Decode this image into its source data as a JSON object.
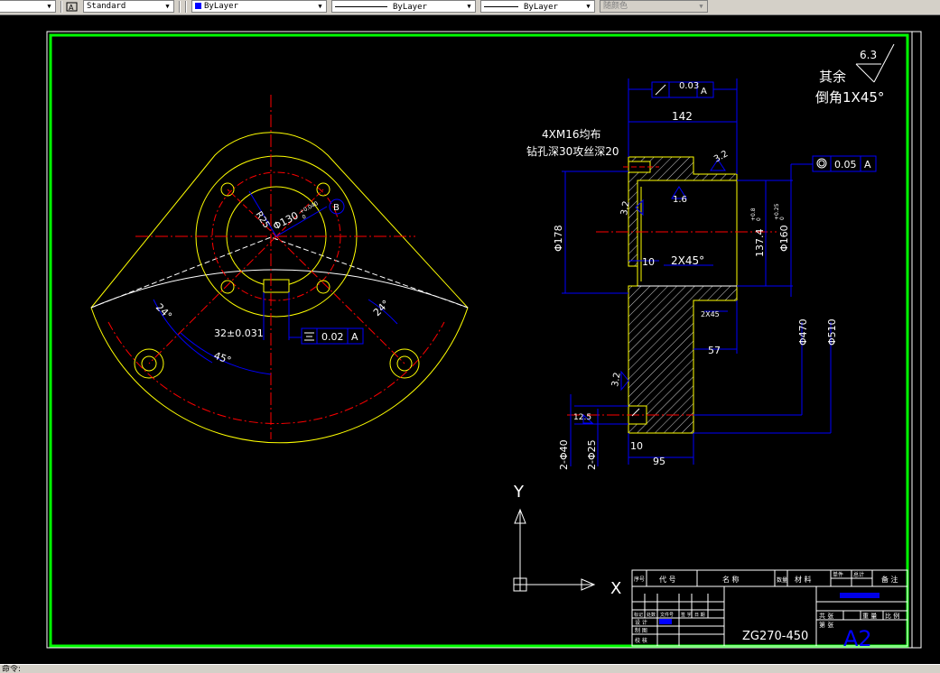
{
  "toolbar": {
    "text_style_value": "Standard",
    "layer_value": "ByLayer",
    "linetype_value": "ByLayer",
    "lineweight_value": "ByLayer",
    "plotstyle_value": "随颜色"
  },
  "colors": {
    "yellow": "#ffff00",
    "red": "#ff0000",
    "blue": "#0000ff",
    "green": "#00ff00",
    "white": "#ffffff",
    "background": "#000000"
  },
  "drawing": {
    "note_line1": "其余",
    "note_line2": "倒角1X45°",
    "roughness_main": "6.3",
    "thread_line1": "4XM16均布",
    "thread_line2": "钻孔深30攻丝深20",
    "dim_142": "142",
    "flatness": "0.03",
    "datum_a": "A",
    "concentricity": "0.05",
    "dim_178": "Φ178",
    "dim_137": "137.4",
    "dim_137_tol_upper": "+0.8",
    "dim_137_tol_lower": "0",
    "dim_160": "Φ160",
    "dim_160_tol_upper": "+0.25",
    "dim_160_tol_lower": "0",
    "dim_470": "Φ470",
    "dim_510": "Φ510",
    "dim_57": "57",
    "dim_95": "95",
    "dim_10a": "10",
    "dim_10b": "10",
    "chamfer_2x45": "2X45°",
    "chamfer_small": "2X45",
    "rough_32a": "3.2",
    "rough_32b": "3.2",
    "rough_32c": "3.2",
    "rough_16": "1.6",
    "rough_125": "12.5",
    "dim_40": "2-Φ40",
    "dim_25": "2-Φ25",
    "dim_32_key": "32±0.031",
    "symmetry": "0.02",
    "angle_24a": "24°",
    "angle_24b": "24°",
    "angle_45": "45°",
    "dim_r25": "R25",
    "dim_130": "Φ130",
    "dim_130_tol_upper": "+0.040",
    "dim_130_tol_lower": "0",
    "datum_b": "B",
    "axis_y": "Y",
    "axis_x": "X"
  },
  "title_block": {
    "col_seq": "序号",
    "col_code": "代 号",
    "col_name": "名 称",
    "col_qty": "数量",
    "col_material": "材 料",
    "col_unit_weight": "单件",
    "col_total_weight": "总计",
    "col_remarks": "备 注",
    "row_mark": "标记",
    "row_count": "处数",
    "row_file": "文件号",
    "row_sign": "签 字",
    "row_date": "日 期",
    "row_design": "设 计",
    "row_draw": "制 图",
    "row_check": "校 核",
    "row_total_sheets": "共 张",
    "row_sheet": "第 张",
    "row_weight": "重 量",
    "row_scale": "比 例",
    "drawing_number": "ZG270-450",
    "sheet_size": "A2"
  },
  "status": {
    "command_prompt": "命令:"
  }
}
